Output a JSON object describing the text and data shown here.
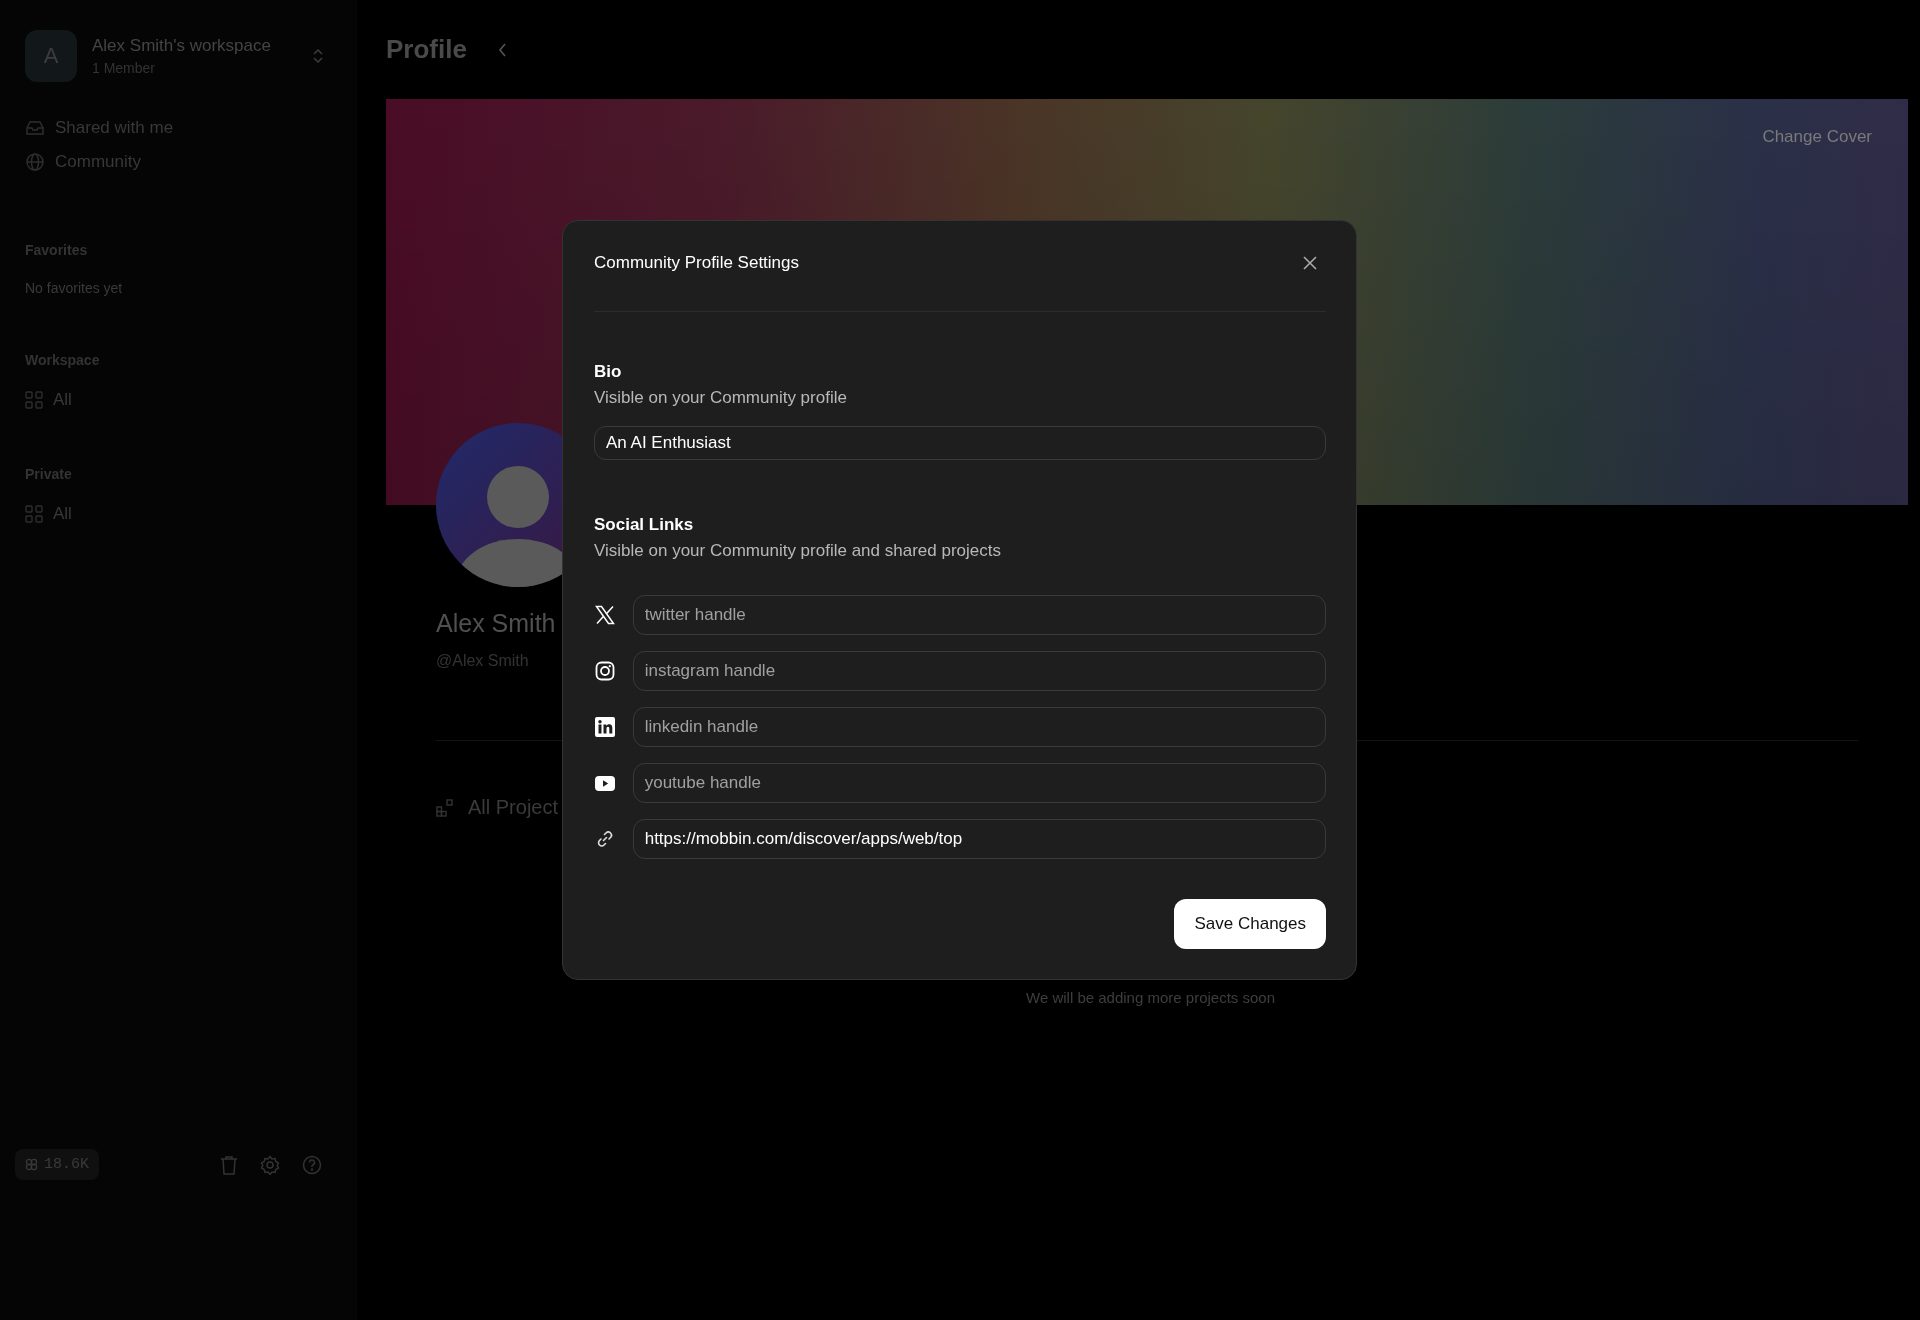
{
  "sidebar": {
    "workspace": {
      "initial": "A",
      "name": "Alex Smith's workspace",
      "members": "1 Member"
    },
    "nav": [
      {
        "kind": "inbox",
        "label": "Shared with me"
      },
      {
        "kind": "globe",
        "label": "Community"
      }
    ],
    "sections": [
      {
        "title": "Favorites",
        "empty": "No favorites yet"
      },
      {
        "title": "Workspace",
        "items": [
          "All"
        ]
      },
      {
        "title": "Private",
        "items": [
          "All"
        ]
      }
    ],
    "credits": "18.6K"
  },
  "page": {
    "title": "Profile",
    "cover_button": "Change Cover",
    "name": "Alex Smith",
    "handle": "@Alex Smith",
    "projects_tab": "All Project",
    "empty_note": "We will be adding more projects soon"
  },
  "modal": {
    "title": "Community Profile Settings",
    "bio": {
      "label": "Bio",
      "hint": "Visible on your Community profile",
      "value": "An AI Enthusiast"
    },
    "social": {
      "label": "Social Links",
      "hint": "Visible on your Community profile and shared projects",
      "links": [
        {
          "kind": "x",
          "placeholder": "twitter handle"
        },
        {
          "kind": "instagram",
          "placeholder": "instagram handle"
        },
        {
          "kind": "linkedin",
          "placeholder": "linkedin handle"
        },
        {
          "kind": "youtube",
          "placeholder": "youtube handle"
        },
        {
          "kind": "link",
          "value": "https://mobbin.com/discover/apps/web/top"
        }
      ]
    },
    "save": "Save Changes"
  }
}
